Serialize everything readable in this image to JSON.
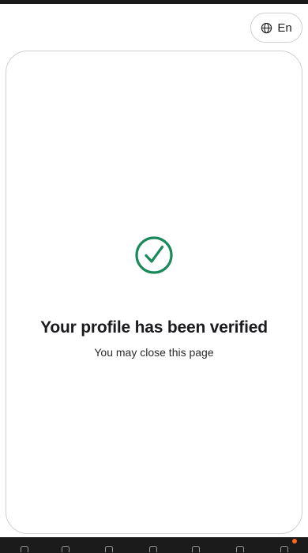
{
  "language": {
    "label": "En",
    "icon": "globe-icon"
  },
  "status": {
    "icon": "check-circle-icon",
    "title": "Your profile has been verified",
    "subtitle": "You may close this page"
  },
  "colors": {
    "accent": "#1b8a5a",
    "text": "#1b1b1f",
    "border": "#cfcfcf"
  }
}
